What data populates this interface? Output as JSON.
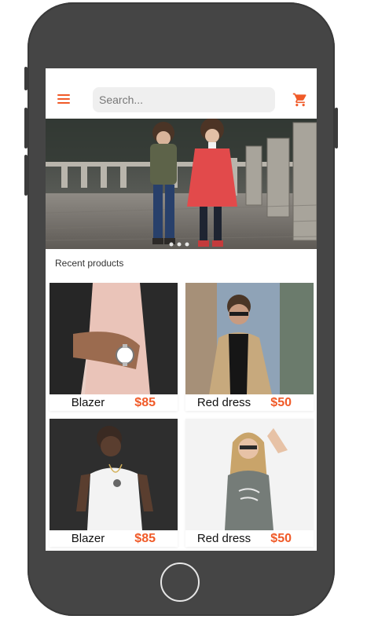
{
  "header": {
    "menu_icon": "hamburger-menu-icon",
    "cart_icon": "shopping-cart-icon",
    "accent_color": "#f05a28"
  },
  "search": {
    "placeholder": "Search...",
    "value": ""
  },
  "banner": {
    "description_icon": "hero-photo",
    "dot_count": 3
  },
  "section": {
    "title": "Recent products"
  },
  "products": [
    {
      "name": "Blazer",
      "price": "$85"
    },
    {
      "name": "Red dress",
      "price": "$50"
    },
    {
      "name": "Blazer",
      "price": "$85"
    },
    {
      "name": "Red dress",
      "price": "$50"
    }
  ]
}
